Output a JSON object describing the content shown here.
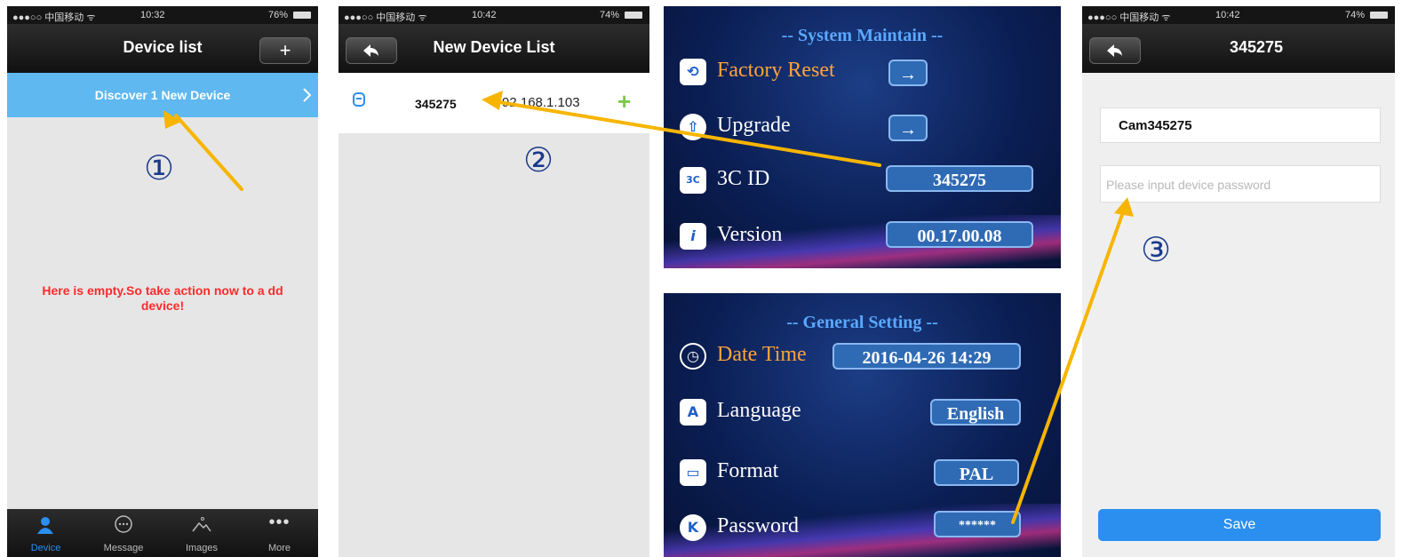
{
  "colors": {
    "accent": "#2b8ff0",
    "highlight": "#5fb8f0",
    "warning_text": "#ff2a2a",
    "arrow": "#f7b500",
    "tv_orange": "#ffa33a"
  },
  "panel1": {
    "status": {
      "carrier": "●●●○○ 中国移动 ᯤ",
      "time": "10:32",
      "battery": "76%"
    },
    "title": "Device list",
    "add_icon": "+",
    "banner": "Discover 1 New Device",
    "step": "①",
    "empty_message": "Here is empty.So take action now to a dd device!",
    "tabs": [
      {
        "label": "Device",
        "icon": "person-icon"
      },
      {
        "label": "Message",
        "icon": "chat-icon"
      },
      {
        "label": "Images",
        "icon": "image-icon"
      },
      {
        "label": "More",
        "icon": "more-icon"
      }
    ]
  },
  "panel2": {
    "status": {
      "carrier": "●●●○○ 中国移动 ᯤ",
      "time": "10:42",
      "battery": "74%"
    },
    "back_icon": "◀",
    "title": "New Device List",
    "device": {
      "id": "345275",
      "ip": "92.168.1.103"
    },
    "step": "②"
  },
  "tv1": {
    "title": "-- System Maintain --",
    "rows": [
      {
        "label": "Factory Reset",
        "value": "→"
      },
      {
        "label": "Upgrade",
        "value": "→"
      },
      {
        "label": "3C ID",
        "value": "345275"
      },
      {
        "label": "Version",
        "value": "00.17.00.08"
      }
    ]
  },
  "tv2": {
    "title": "-- General Setting --",
    "rows": [
      {
        "label": "Date Time",
        "value": "2016-04-26   14:29"
      },
      {
        "label": "Language",
        "value": "English"
      },
      {
        "label": "Format",
        "value": "PAL"
      },
      {
        "label": "Password",
        "value": "******"
      }
    ]
  },
  "panel4": {
    "status": {
      "carrier": "●●●○○ 中国移动 ᯤ",
      "time": "10:42",
      "battery": "74%"
    },
    "title": "345275",
    "name_value": "Cam345275",
    "password_placeholder": "Please input device password",
    "step": "③",
    "save_label": "Save"
  }
}
